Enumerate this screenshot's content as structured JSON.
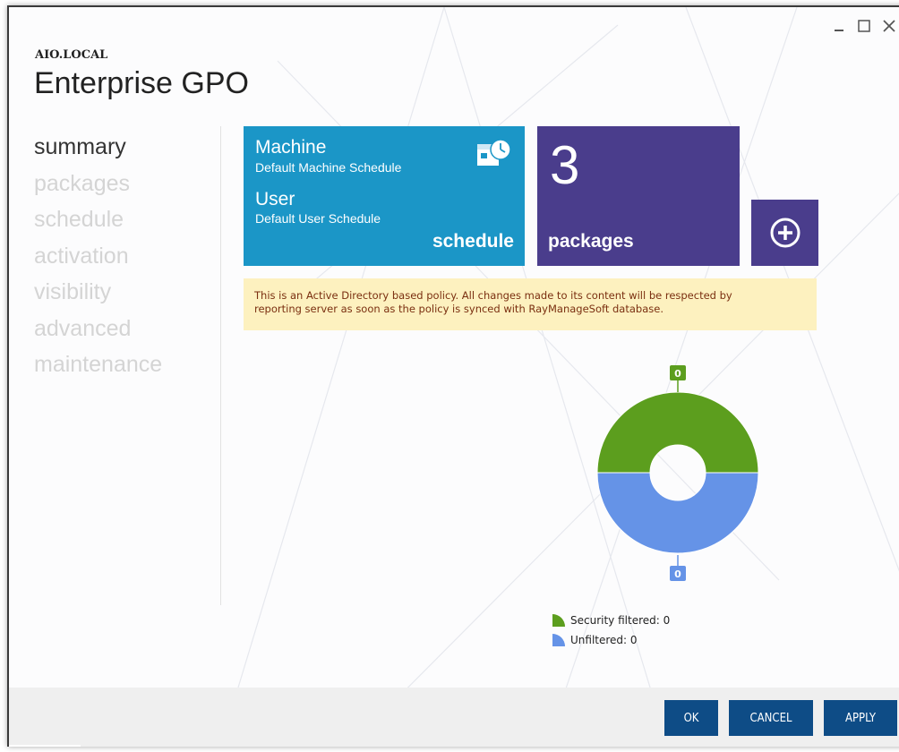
{
  "window": {
    "subtitle": "AIO.LOCAL",
    "title": "Enterprise GPO"
  },
  "window_controls": [
    "minimize-icon",
    "maximize-icon",
    "close-icon"
  ],
  "nav": {
    "items": [
      {
        "label": "summary",
        "active": true
      },
      {
        "label": "packages"
      },
      {
        "label": "schedule"
      },
      {
        "label": "activation"
      },
      {
        "label": "visibility"
      },
      {
        "label": "advanced"
      },
      {
        "label": "maintenance"
      }
    ]
  },
  "tiles": {
    "schedule": {
      "machine_label": "Machine",
      "machine_value": "Default Machine Schedule",
      "user_label": "User",
      "user_value": "Default User Schedule",
      "caption": "schedule",
      "icon": "calendar-clock-icon",
      "color": "#1b96c7"
    },
    "packages": {
      "count": "3",
      "caption": "packages",
      "color": "#4a3d8c"
    },
    "add": {
      "icon": "plus-circle-icon"
    }
  },
  "notice": {
    "line1": "This is an Active Directory based policy. All changes made to its content will be respected by",
    "line2": "reporting server as soon as the policy is synced with RayManageSoft database."
  },
  "chart_data": {
    "type": "pie",
    "series": [
      {
        "name": "Security filtered",
        "value": 0,
        "label": "0",
        "color": "#5c9e1e"
      },
      {
        "name": "Unfiltered",
        "value": 0,
        "label": "0",
        "color": "#6593e7"
      }
    ]
  },
  "legend": [
    "Security filtered: 0",
    "Unfiltered: 0"
  ],
  "footer": {
    "ok": "OK",
    "cancel": "CANCEL",
    "apply": "APPLY"
  }
}
